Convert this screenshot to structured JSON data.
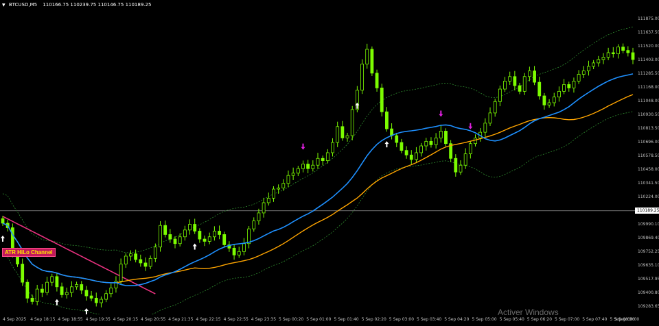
{
  "title": {
    "symbol_timeframe": "BTCUSD,M5",
    "ohlc": "110166.75 110239.75 110146.75 110189.25"
  },
  "indicator_badge": "ATR HiLo Channel",
  "current_price": "110189.25",
  "watermark": "Activer Windows",
  "price_labels": [
    "111875.00",
    "111637.50",
    "111520.00",
    "111403.00",
    "111285.50",
    "111168.00",
    "111048.00",
    "110930.50",
    "110813.50",
    "110696.00",
    "110578.50",
    "110458.00",
    "110341.50",
    "110224.00",
    "110107.25",
    "109990.10",
    "109869.40",
    "109752.25",
    "109635.10",
    "109517.95",
    "109400.80",
    "109283.65"
  ],
  "time_labels": [
    "4 Sep 2025",
    "4 Sep 18:15",
    "4 Sep 18:55",
    "4 Sep 19:35",
    "4 Sep 20:15",
    "4 Sep 20:55",
    "4 Sep 21:35",
    "4 Sep 22:15",
    "4 Sep 22:55",
    "4 Sep 23:35",
    "5 Sep 00:20",
    "5 Sep 01:00",
    "5 Sep 01:40",
    "5 Sep 02:20",
    "5 Sep 03:00",
    "5 Sep 03:40",
    "5 Sep 04:20",
    "5 Sep 05:00",
    "5 Sep 05:40",
    "5 Sep 06:20",
    "5 Sep 07:00",
    "5 Sep 07:40",
    "5 Sep 08:20",
    "5 Sep 09:00"
  ],
  "colors": {
    "candle": "#7CFC00",
    "ma_blue": "#1e90ff",
    "ma_orange": "#ffa500",
    "ma_pink": "#e8317f",
    "channel": "#2e8b2e",
    "buy_arrow": "#ffffff",
    "sell_arrow": "#e020e0"
  },
  "chart_data": {
    "type": "candlestick",
    "symbol": "BTCUSD",
    "timeframe": "M5",
    "ylim": [
      109283.65,
      111875.0
    ],
    "close": [
      110080,
      110040,
      109820,
      109720,
      109560,
      109420,
      109390,
      109500,
      109470,
      109560,
      109610,
      109520,
      109450,
      109470,
      109520,
      109540,
      109490,
      109440,
      109420,
      109380,
      109410,
      109460,
      109510,
      109570,
      109720,
      109790,
      109810,
      109760,
      109730,
      109700,
      109770,
      109870,
      110060,
      109980,
      109940,
      109900,
      109960,
      110020,
      110070,
      110010,
      109940,
      109920,
      109960,
      110010,
      109980,
      109890,
      109860,
      109800,
      109830,
      109900,
      110030,
      110100,
      110170,
      110260,
      110300,
      110380,
      110390,
      110430,
      110500,
      110520,
      110560,
      110600,
      110560,
      110590,
      110650,
      110630,
      110700,
      110790,
      110930,
      110830,
      110850,
      111080,
      111250,
      111480,
      111610,
      111400,
      111270,
      111060,
      110910,
      110850,
      110790,
      110720,
      110680,
      110640,
      110700,
      110760,
      110800,
      110770,
      110830,
      110890,
      110780,
      110650,
      110530,
      110590,
      110690,
      110780,
      110830,
      110880,
      110960,
      111050,
      111150,
      111260,
      111330,
      111370,
      111290,
      111240,
      111370,
      111420,
      111320,
      111200,
      111120,
      111140,
      111190,
      111240,
      111300,
      111270,
      111330,
      111390,
      111420,
      111460,
      111490,
      111520,
      111540,
      111580,
      111570,
      111630,
      111600,
      111580,
      111520
    ],
    "buy_arrows": [
      "4 Sep 2025",
      "4 Sep 18:55",
      "4 Sep 19:35",
      "4 Sep 22:15",
      "5 Sep 02:20",
      "5 Sep 03:00"
    ],
    "sell_arrows": [
      "5 Sep 01:00",
      "5 Sep 04:20",
      "5 Sep 05:00"
    ]
  }
}
